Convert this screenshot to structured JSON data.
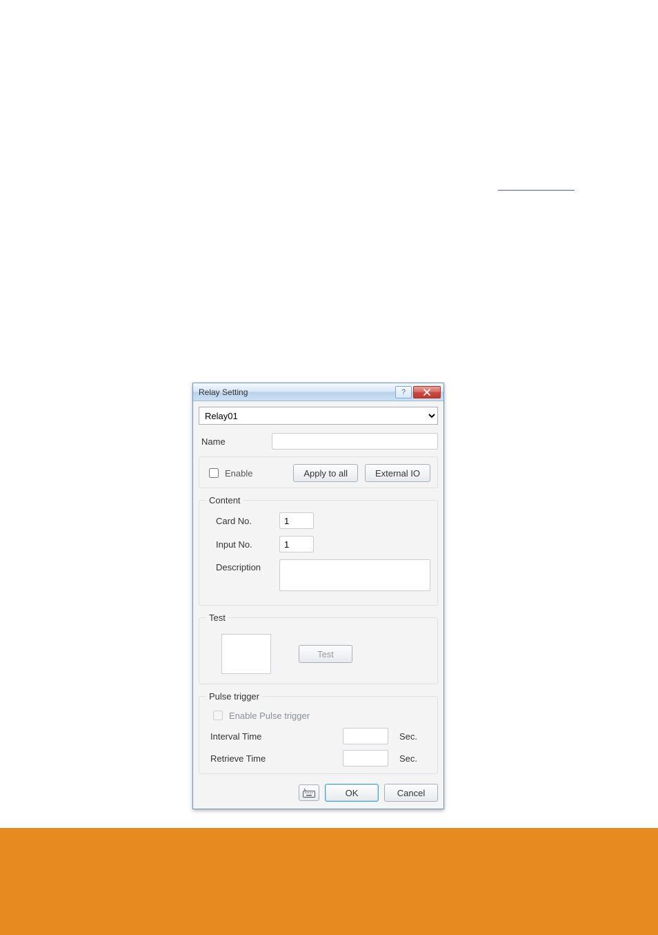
{
  "dialog": {
    "title": "Relay Setting",
    "relay_selected": "Relay01",
    "name_label": "Name",
    "name_value": "",
    "enable_label": "Enable",
    "enable_checked": false,
    "apply_all_label": "Apply to all",
    "external_io_label": "External IO",
    "content": {
      "legend": "Content",
      "card_no_label": "Card No.",
      "card_no_value": "1",
      "input_no_label": "Input No.",
      "input_no_value": "1",
      "description_label": "Description",
      "description_value": ""
    },
    "test": {
      "legend": "Test",
      "test_button_label": "Test"
    },
    "pulse": {
      "legend": "Pulse trigger",
      "enable_pulse_label": "Enable Pulse trigger",
      "enable_pulse_checked": false,
      "interval_label": "Interval Time",
      "interval_value": "",
      "retrieve_label": "Retrieve Time",
      "retrieve_value": "",
      "unit": "Sec."
    },
    "buttons": {
      "ok": "OK",
      "cancel": "Cancel"
    }
  }
}
